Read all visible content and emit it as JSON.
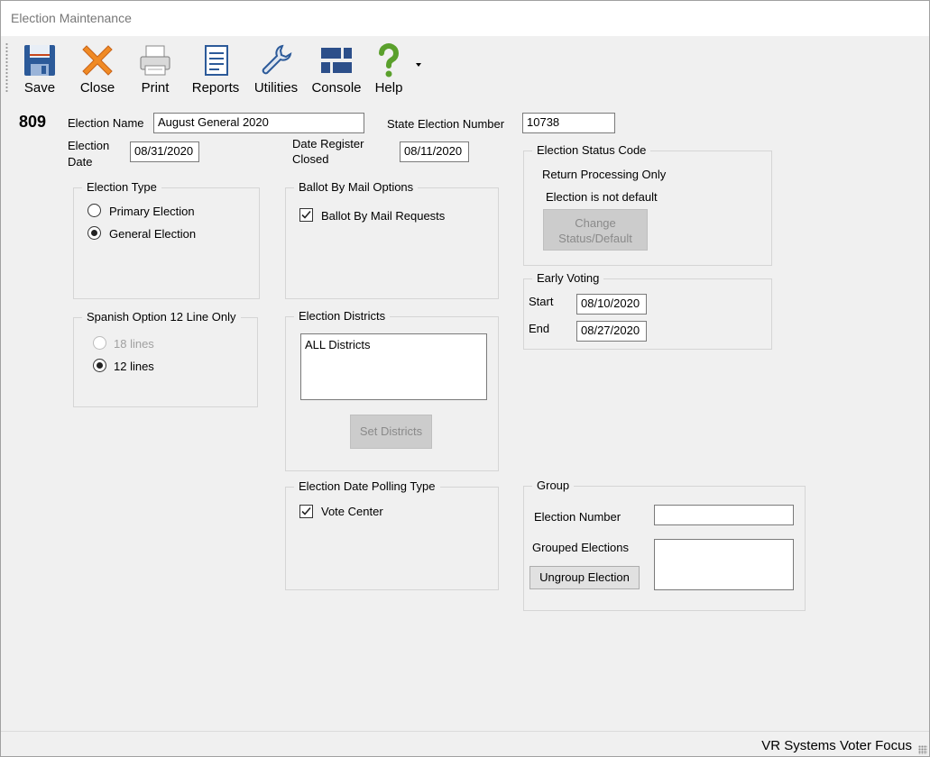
{
  "window": {
    "title": "Election Maintenance"
  },
  "toolbar": {
    "save": "Save",
    "close": "Close",
    "print": "Print",
    "reports": "Reports",
    "utilities": "Utilities",
    "console": "Console",
    "help": "Help"
  },
  "form": {
    "election_id": "809",
    "election_name_label": "Election Name",
    "election_name_value": "August General 2020",
    "state_election_number_label": "State Election Number",
    "state_election_number_value": "10738",
    "election_date_label_1": "Election",
    "election_date_label_2": "Date",
    "election_date_value": "08/31/2020",
    "date_register_closed_label_1": "Date Register",
    "date_register_closed_label_2": "Closed",
    "date_register_closed_value": "08/11/2020"
  },
  "election_type": {
    "title": "Election Type",
    "options": [
      "Primary Election",
      "General Election"
    ],
    "selected": "General Election"
  },
  "spanish_option": {
    "title": "Spanish Option 12 Line Only",
    "options": [
      "18 lines",
      "12 lines"
    ],
    "selected": "12 lines"
  },
  "ballot_by_mail": {
    "title": "Ballot By Mail Options",
    "requests_label": "Ballot By Mail Requests",
    "requests_checked": true
  },
  "election_districts": {
    "title": "Election Districts",
    "items": [
      "ALL Districts"
    ],
    "set_button": "Set Districts"
  },
  "polling_type": {
    "title": "Election Date Polling Type",
    "vote_center_label": "Vote Center",
    "vote_center_checked": true
  },
  "status_code": {
    "title": "Election Status Code",
    "line1": "Return Processing Only",
    "line2": "Election is not default",
    "change_button_1": "Change",
    "change_button_2": "Status/Default"
  },
  "early_voting": {
    "title": "Early Voting",
    "start_label": "Start",
    "start_value": "08/10/2020",
    "end_label": "End",
    "end_value": "08/27/2020"
  },
  "group": {
    "title": "Group",
    "election_number_label": "Election Number",
    "election_number_value": "",
    "grouped_elections_label": "Grouped Elections",
    "ungroup_button": "Ungroup Election"
  },
  "status_bar": {
    "text": "VR Systems Voter Focus"
  }
}
